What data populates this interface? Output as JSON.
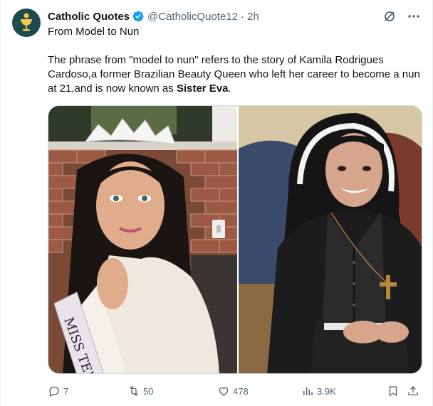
{
  "author": {
    "name": "Catholic Quotes",
    "handle": "@CatholicQuote12",
    "separator": "·",
    "time": "2h",
    "avatar_icon": "chalice-icon",
    "verified_color": "#1d9bf0"
  },
  "tweet": {
    "title_line": "From Model to Nun",
    "body_before_bold": "The phrase from \"model to nun\" refers to the story of Kamila Rodrigues Cardoso,a former Brazilian Beauty Queen who left her career to become a nun at 21,and is now known as ",
    "body_bold": "Sister Eva",
    "body_after_bold": "."
  },
  "media": {
    "left_photo": {
      "sash_text": "MISS TEE",
      "description_icon": "beauty-queen-photo"
    },
    "right_photo": {
      "description_icon": "nun-photo"
    }
  },
  "actions": {
    "replies": "7",
    "reposts": "50",
    "likes": "478",
    "views": "3.9K"
  },
  "colors": {
    "text": "#0f1419",
    "muted": "#536471",
    "accent": "#1d9bf0"
  }
}
